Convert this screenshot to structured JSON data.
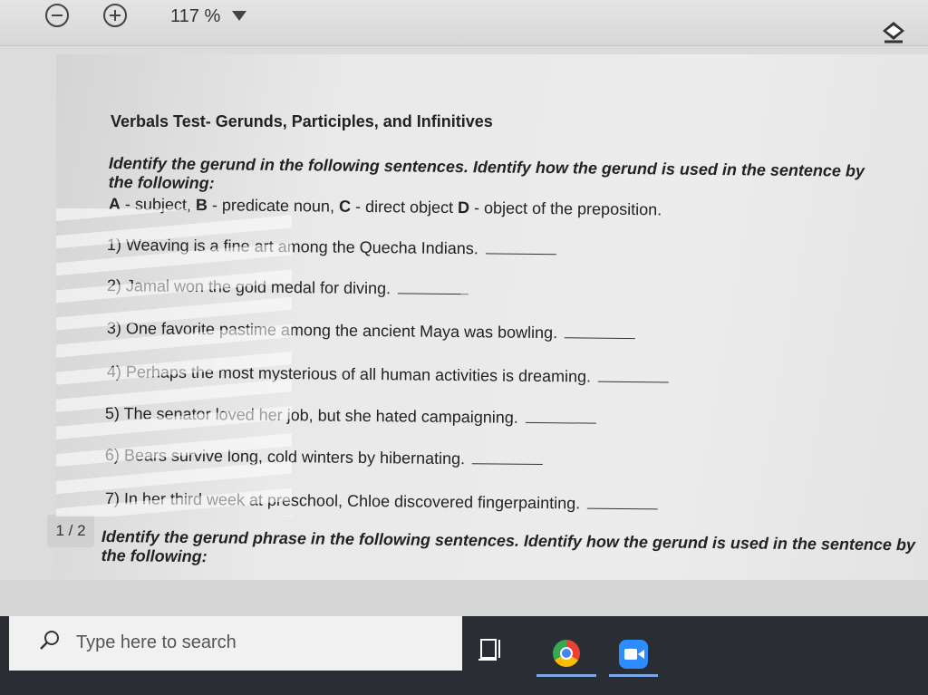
{
  "toolbar": {
    "zoom_out_icon": "minus-circle-icon",
    "zoom_in_icon": "plus-circle-icon",
    "zoom_level": "117 %",
    "zoom_dropdown_icon": "caret-down-icon",
    "erase_icon": "eraser-icon"
  },
  "document": {
    "title": "Verbals Test- Gerunds, Participles, and Infinitives",
    "instruction": "Identify the gerund in the following sentences.  Identify how the gerund is used in the sentence by the following:",
    "legend": [
      {
        "letter": "A",
        "text": " - subject,  "
      },
      {
        "letter": "B",
        "text": " - predicate noun, "
      },
      {
        "letter": "C",
        "text": " - direct object  "
      },
      {
        "letter": "D",
        "text": " - object of the preposition."
      }
    ],
    "questions": [
      "1) Weaving is a fine art among the Quecha Indians.",
      "2) Jamal won the gold medal for diving.",
      "3) One favorite pastime among the ancient Maya was bowling.",
      "4) Perhaps the most mysterious of all human activities is dreaming.",
      "5) The senator loved her job, but she hated campaigning.",
      "6) Bears survive long, cold winters by hibernating.",
      "7) In her third week at preschool, Chloe discovered fingerpainting."
    ],
    "instruction2": "Identify the gerund phrase in the following sentences.  Identify how the gerund is used in the sentence by the following:",
    "page_indicator": "1 / 2"
  },
  "taskbar": {
    "search_placeholder": "Type here to search",
    "search_icon": "search-icon",
    "apps": [
      "task-view-icon",
      "chrome-icon",
      "zoom-app-icon"
    ]
  }
}
